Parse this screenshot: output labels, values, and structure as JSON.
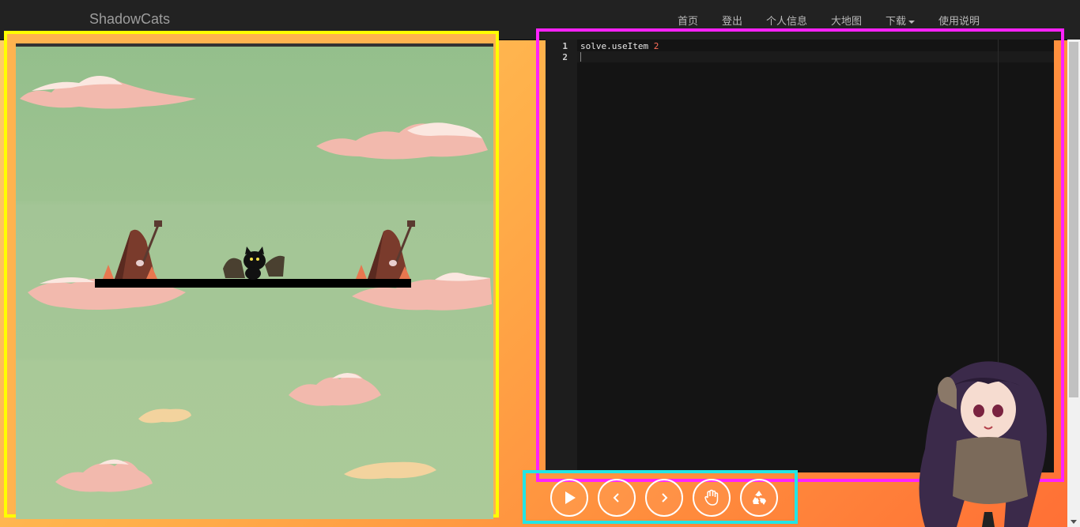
{
  "navbar": {
    "brand": "ShadowCats",
    "links": [
      {
        "label": "首页"
      },
      {
        "label": "登出"
      },
      {
        "label": "个人信息"
      },
      {
        "label": "大地图"
      },
      {
        "label": "下载"
      },
      {
        "label": "使用说明"
      }
    ]
  },
  "editor": {
    "line_numbers": [
      "1",
      "2"
    ],
    "code": {
      "line1_text": "solve.useItem ",
      "line1_number": "2",
      "line2_text": ""
    }
  },
  "controls": [
    {
      "icon": "play-icon"
    },
    {
      "icon": "step-back-icon"
    },
    {
      "icon": "step-forward-icon"
    },
    {
      "icon": "stop-hand-icon"
    },
    {
      "icon": "recycle-reset-icon"
    }
  ],
  "colors": {
    "navbar_bg": "#222222",
    "game_frame_border": "#ffff00",
    "editor_frame_border": "#ff22ff",
    "controls_frame_border": "#22e5e5",
    "editor_bg": "#141414",
    "code_number": "#ff6e5a"
  }
}
